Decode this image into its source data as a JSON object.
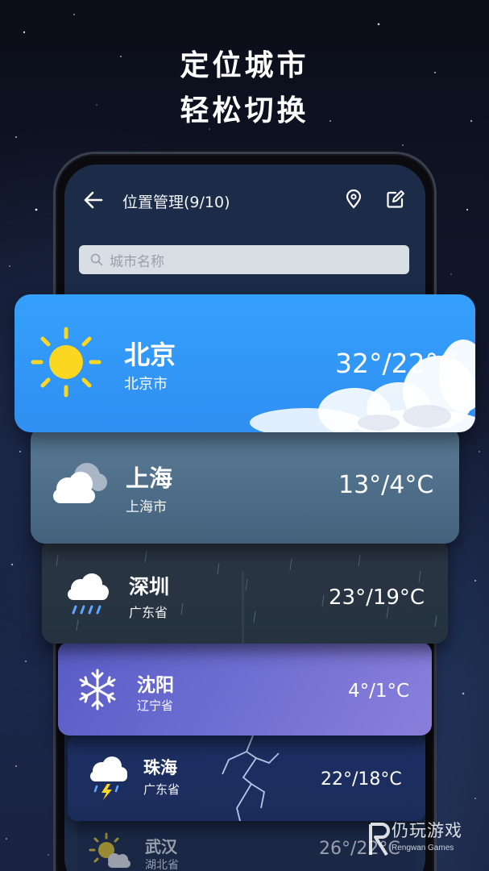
{
  "headline": {
    "line1": "定位城市",
    "line2": "轻松切换"
  },
  "appbar": {
    "title": "位置管理(9/10)"
  },
  "search": {
    "placeholder": "城市名称"
  },
  "cities": [
    {
      "name": "北京",
      "region": "北京市",
      "temp": "32°/22°C",
      "icon": "sun-icon"
    },
    {
      "name": "上海",
      "region": "上海市",
      "temp": "13°/4°C",
      "icon": "cloudy-icon"
    },
    {
      "name": "深圳",
      "region": "广东省",
      "temp": "23°/19°C",
      "icon": "rain-icon"
    },
    {
      "name": "沈阳",
      "region": "辽宁省",
      "temp": "4°/1°C",
      "icon": "snowflake-icon"
    },
    {
      "name": "珠海",
      "region": "广东省",
      "temp": "22°/18°C",
      "icon": "thunderstorm-icon"
    },
    {
      "name": "武汉",
      "region": "湖北省",
      "temp": "26°/22°C",
      "icon": "partly-sunny-icon"
    }
  ],
  "watermark": {
    "cn": "仍玩游戏",
    "en": "Rengwan Games"
  },
  "colors": {
    "card_sunny": "#35a0fb",
    "card_cloudy": "#5b7c99",
    "card_rain": "#2b3644",
    "card_snow": "#6f6fd2",
    "card_storm": "#1d2f63"
  }
}
